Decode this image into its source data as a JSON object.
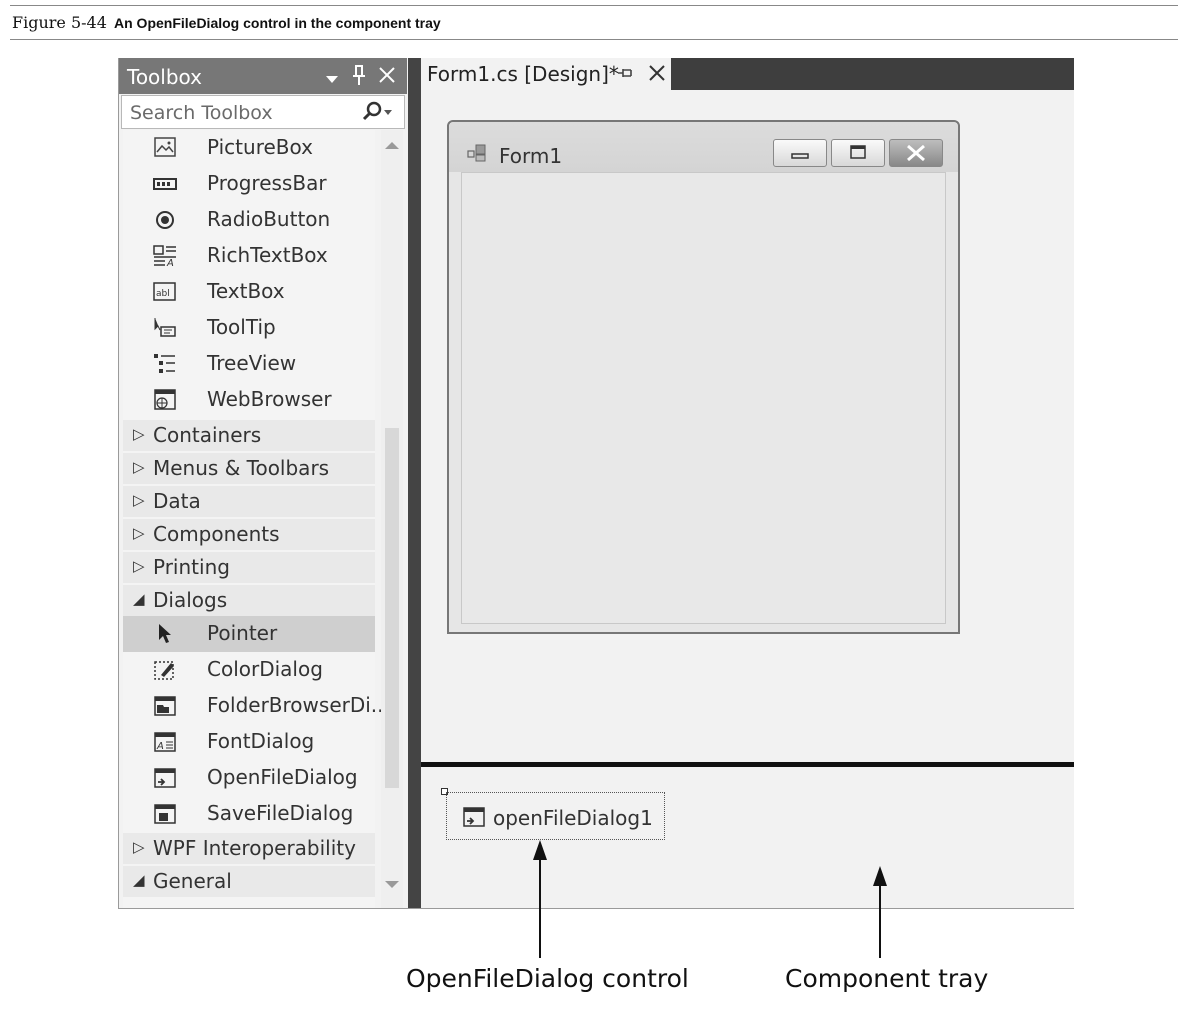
{
  "figure": {
    "number": "Figure 5-44",
    "title": "An OpenFileDialog control in the component tray"
  },
  "toolbox": {
    "title": "Toolbox",
    "search_placeholder": "Search Toolbox",
    "items_top": [
      {
        "label": "PictureBox",
        "icon": "picturebox-icon"
      },
      {
        "label": "ProgressBar",
        "icon": "progressbar-icon"
      },
      {
        "label": "RadioButton",
        "icon": "radiobutton-icon"
      },
      {
        "label": "RichTextBox",
        "icon": "richtextbox-icon"
      },
      {
        "label": "TextBox",
        "icon": "textbox-icon"
      },
      {
        "label": "ToolTip",
        "icon": "tooltip-icon"
      },
      {
        "label": "TreeView",
        "icon": "treeview-icon"
      },
      {
        "label": "WebBrowser",
        "icon": "webbrowser-icon"
      }
    ],
    "categories_collapsed": [
      "Containers",
      "Menus & Toolbars",
      "Data",
      "Components",
      "Printing"
    ],
    "category_expanded": "Dialogs",
    "dialog_items": [
      {
        "label": "Pointer",
        "icon": "pointer-icon",
        "selected": true
      },
      {
        "label": "ColorDialog",
        "icon": "colordialog-icon"
      },
      {
        "label": "FolderBrowserDi...",
        "icon": "folderbrowserdialog-icon"
      },
      {
        "label": "FontDialog",
        "icon": "fontdialog-icon"
      },
      {
        "label": "OpenFileDialog",
        "icon": "openfiledialog-icon"
      },
      {
        "label": "SaveFileDialog",
        "icon": "savefiledialog-icon"
      }
    ],
    "categories_bottom": [
      {
        "label": "WPF Interoperability",
        "expanded": false
      },
      {
        "label": "General",
        "expanded": true
      }
    ]
  },
  "designer": {
    "tab_label": "Form1.cs [Design]*",
    "form_title": "Form1"
  },
  "component_tray": {
    "component_label": "openFileDialog1"
  },
  "callouts": {
    "control": "OpenFileDialog control",
    "tray": "Component tray"
  }
}
